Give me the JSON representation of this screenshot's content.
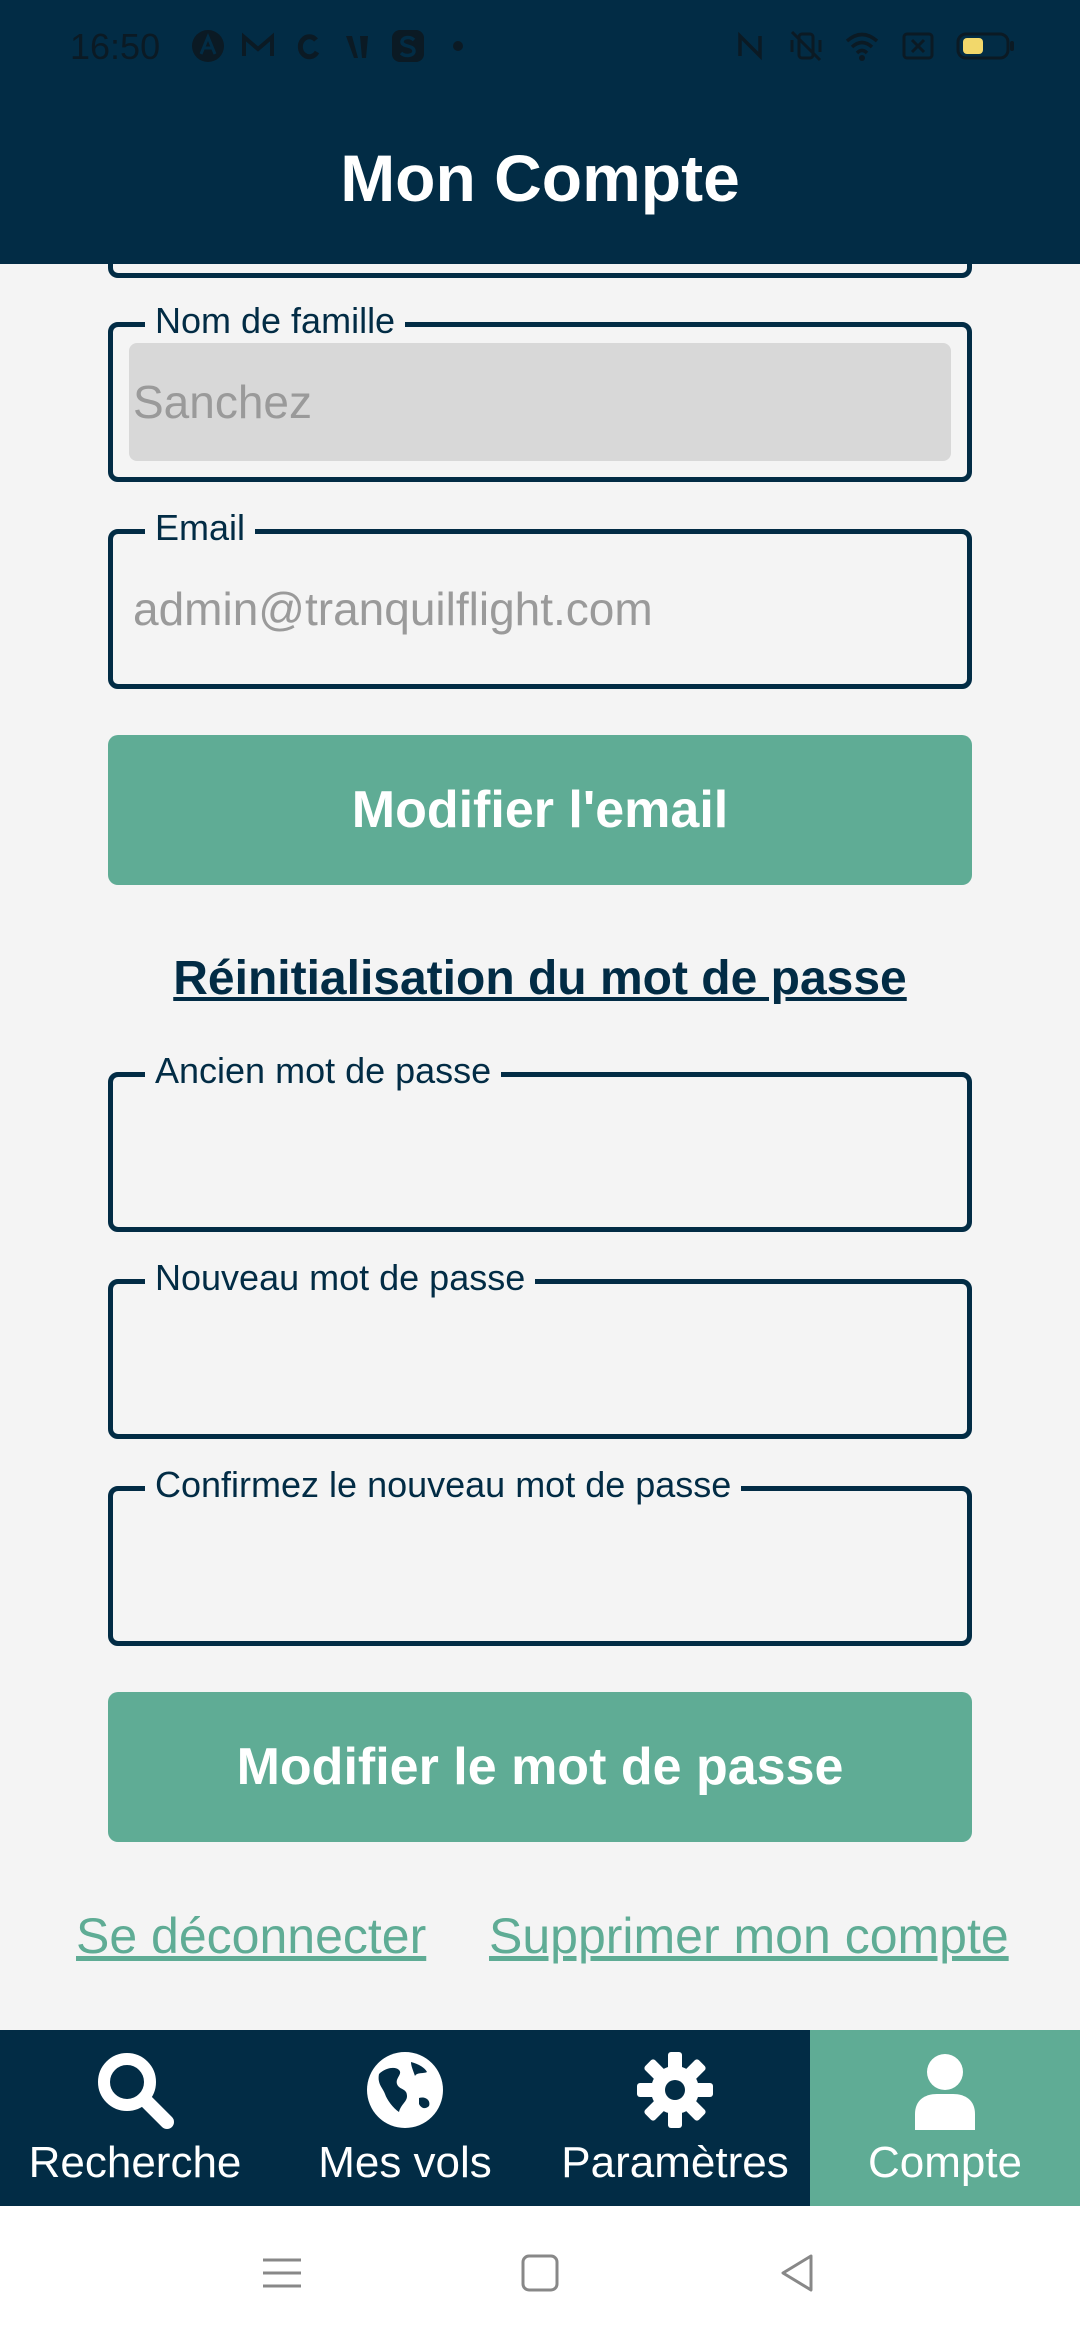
{
  "status_bar": {
    "time": "16:50",
    "notification_icons": [
      "a-icon",
      "gmail-icon",
      "threads-icon",
      "v-icon",
      "s-icon",
      "dot-icon"
    ],
    "system_icons": [
      "nfc-icon",
      "vibrate-icon",
      "wifi-icon",
      "sim-icon",
      "battery-icon"
    ]
  },
  "header": {
    "title": "Mon Compte"
  },
  "form": {
    "last_name": {
      "label": "Nom de famille",
      "value": "Sanchez"
    },
    "email": {
      "label": "Email",
      "placeholder": "admin@tranquilflight.com"
    },
    "modify_email_label": "Modifier l'email",
    "password_section_title": "Réinitialisation du mot de passe",
    "old_password": {
      "label": "Ancien mot de passe",
      "value": ""
    },
    "new_password": {
      "label": "Nouveau mot de passe",
      "value": ""
    },
    "confirm_password": {
      "label": "Confirmez le nouveau mot de passe",
      "value": ""
    },
    "modify_password_label": "Modifier le mot de passe"
  },
  "links": {
    "logout": "Se déconnecter",
    "delete_account": "Supprimer mon compte"
  },
  "bottom_nav": {
    "items": [
      {
        "label": "Recherche",
        "icon": "search-icon"
      },
      {
        "label": "Mes vols",
        "icon": "globe-icon"
      },
      {
        "label": "Paramètres",
        "icon": "gear-icon"
      },
      {
        "label": "Compte",
        "icon": "user-icon"
      }
    ],
    "active_index": 3
  },
  "colors": {
    "primary": "#022c45",
    "accent": "#5fac95",
    "background": "#f4f4f4"
  }
}
